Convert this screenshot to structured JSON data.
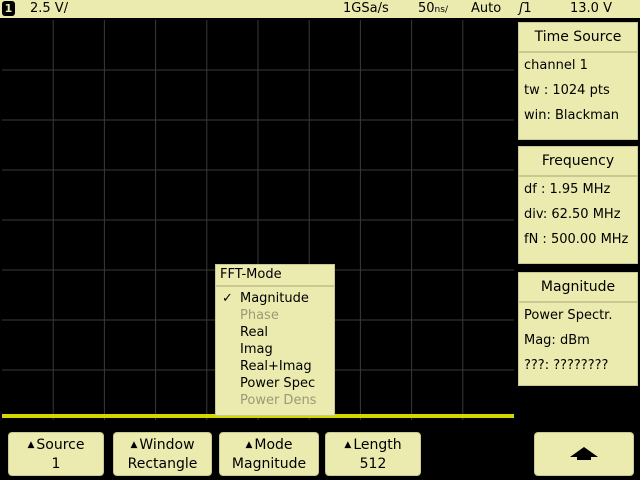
{
  "status_bar": {
    "channel_number": "1",
    "vertical_scale": "2.5 V/",
    "sample_rate": "1GSa/s",
    "timebase": "50",
    "timebase_unit": "ns/",
    "trigger_mode": "Auto",
    "trigger_source": "1",
    "trigger_level": "13.0 V"
  },
  "panels": {
    "time_source": {
      "title": "Time Source",
      "channel": "channel 1",
      "tw": "tw : 1024 pts",
      "win": "win: Blackman"
    },
    "frequency": {
      "title": "Frequency",
      "df": "df :  1.95 MHz",
      "div": "div:  62.50 MHz",
      "fn": "fN : 500.00 MHz"
    },
    "magnitude": {
      "title": "Magnitude",
      "line1": "Power Spectr.",
      "line2": "Mag: dBm",
      "line3": "???: ????????"
    }
  },
  "fft_mode_menu": {
    "title": "FFT-Mode",
    "items": [
      {
        "label": "Magnitude",
        "selected": true,
        "enabled": true
      },
      {
        "label": "Phase",
        "selected": false,
        "enabled": false
      },
      {
        "label": "Real",
        "selected": false,
        "enabled": true
      },
      {
        "label": "Imag",
        "selected": false,
        "enabled": true
      },
      {
        "label": "Real+Imag",
        "selected": false,
        "enabled": true
      },
      {
        "label": "Power Spec",
        "selected": false,
        "enabled": true
      },
      {
        "label": "Power Dens",
        "selected": false,
        "enabled": false
      }
    ],
    "check_glyph": "✓"
  },
  "softkeys": {
    "source": {
      "label": "Source",
      "value": "1"
    },
    "window": {
      "label": "Window",
      "value": "Rectangle"
    },
    "mode": {
      "label": "Mode",
      "value": "Magnitude"
    },
    "length": {
      "label": "Length",
      "value": "512"
    }
  },
  "icons": {
    "softkey_indicator": "triangle-up-icon",
    "back": "arrow-up-icon"
  },
  "colors": {
    "background": "#000000",
    "panel": "#ebebaf",
    "trace": "#d7d400",
    "grid": "#3a3a3a"
  }
}
